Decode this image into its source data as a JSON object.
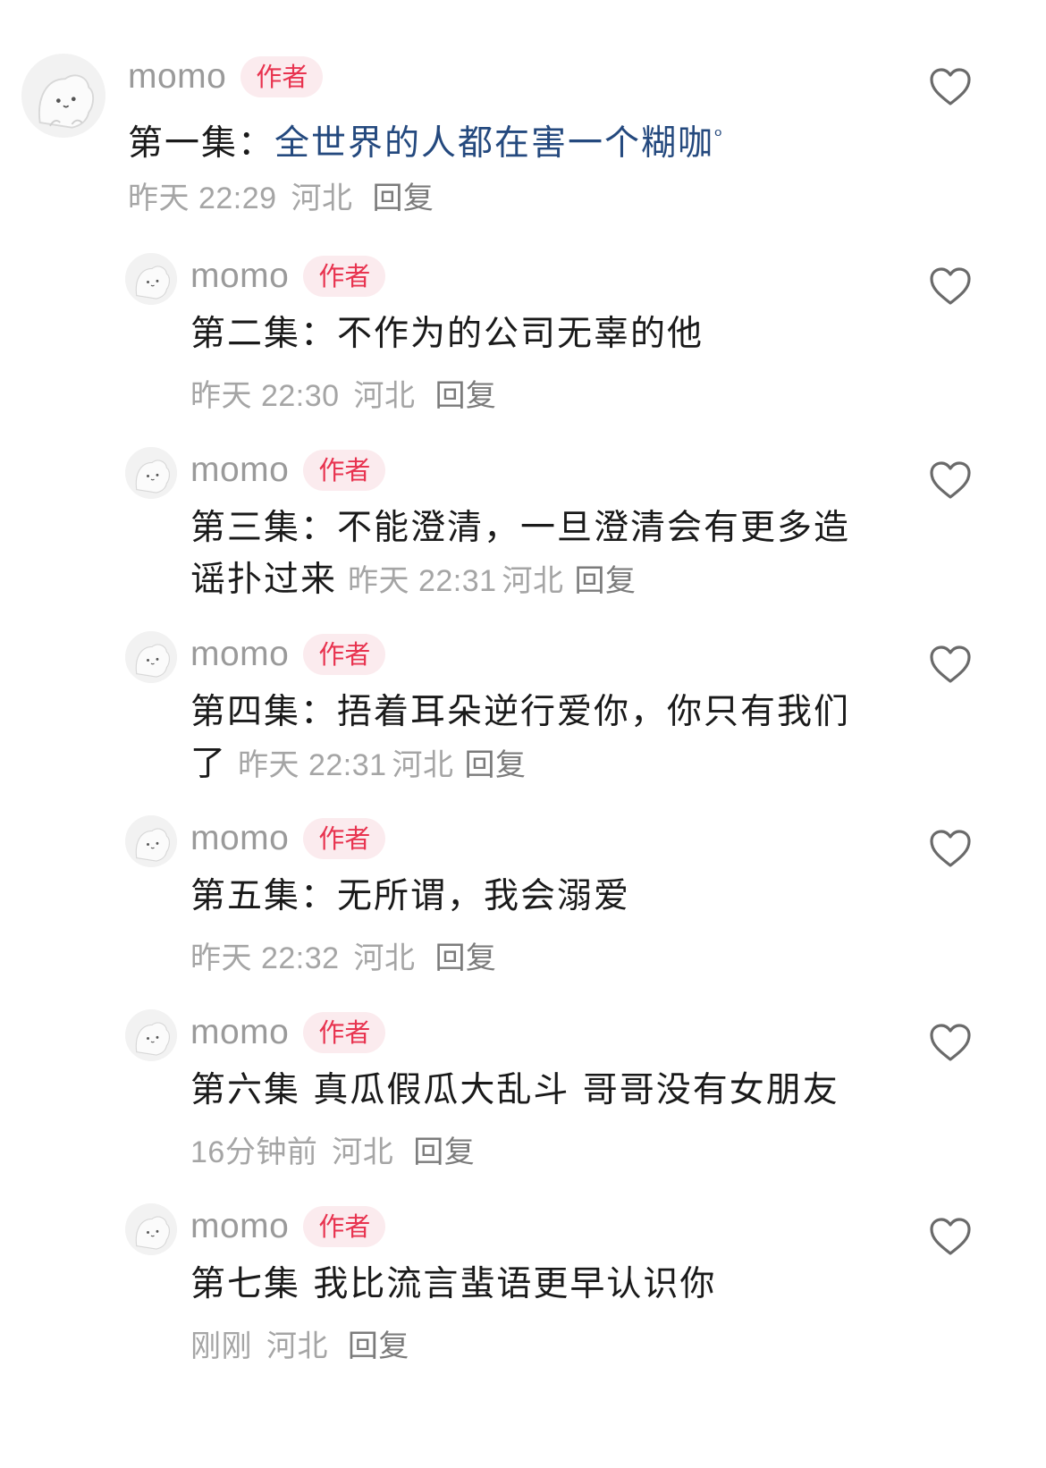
{
  "comments": [
    {
      "username": "momo",
      "badge": "作者",
      "prefix": "第一集：",
      "link_text": "全世界的人都在害一个糊咖",
      "search_mark": "ᵒ",
      "time": "昨天 22:29",
      "location": "河北",
      "reply": "回复"
    },
    {
      "username": "momo",
      "badge": "作者",
      "text": "第二集：不作为的公司无辜的他",
      "time": "昨天 22:30",
      "location": "河北",
      "reply": "回复"
    },
    {
      "username": "momo",
      "badge": "作者",
      "text": "第三集：不能澄清，一旦澄清会有更多造谣扑过来",
      "time": "昨天 22:31",
      "location": "河北",
      "reply": "回复"
    },
    {
      "username": "momo",
      "badge": "作者",
      "text": "第四集：捂着耳朵逆行爱你，你只有我们了",
      "time": "昨天 22:31",
      "location": "河北",
      "reply": "回复"
    },
    {
      "username": "momo",
      "badge": "作者",
      "text": "第五集：无所谓，我会溺爱",
      "time": "昨天 22:32",
      "location": "河北",
      "reply": "回复"
    },
    {
      "username": "momo",
      "badge": "作者",
      "text": "第六集 真瓜假瓜大乱斗 哥哥没有女朋友",
      "time": "16分钟前",
      "location": "河北",
      "reply": "回复"
    },
    {
      "username": "momo",
      "badge": "作者",
      "text": "第七集 我比流言蜚语更早认识你",
      "time": "刚刚",
      "location": "河北",
      "reply": "回复"
    }
  ],
  "colors": {
    "badge_text": "#e8334f",
    "badge_bg": "#fbebee",
    "link": "#24497e",
    "meta": "#a5a5a5"
  },
  "icons": {
    "like": "heart-outline-icon",
    "avatar": "cartoon-bun-avatar"
  }
}
